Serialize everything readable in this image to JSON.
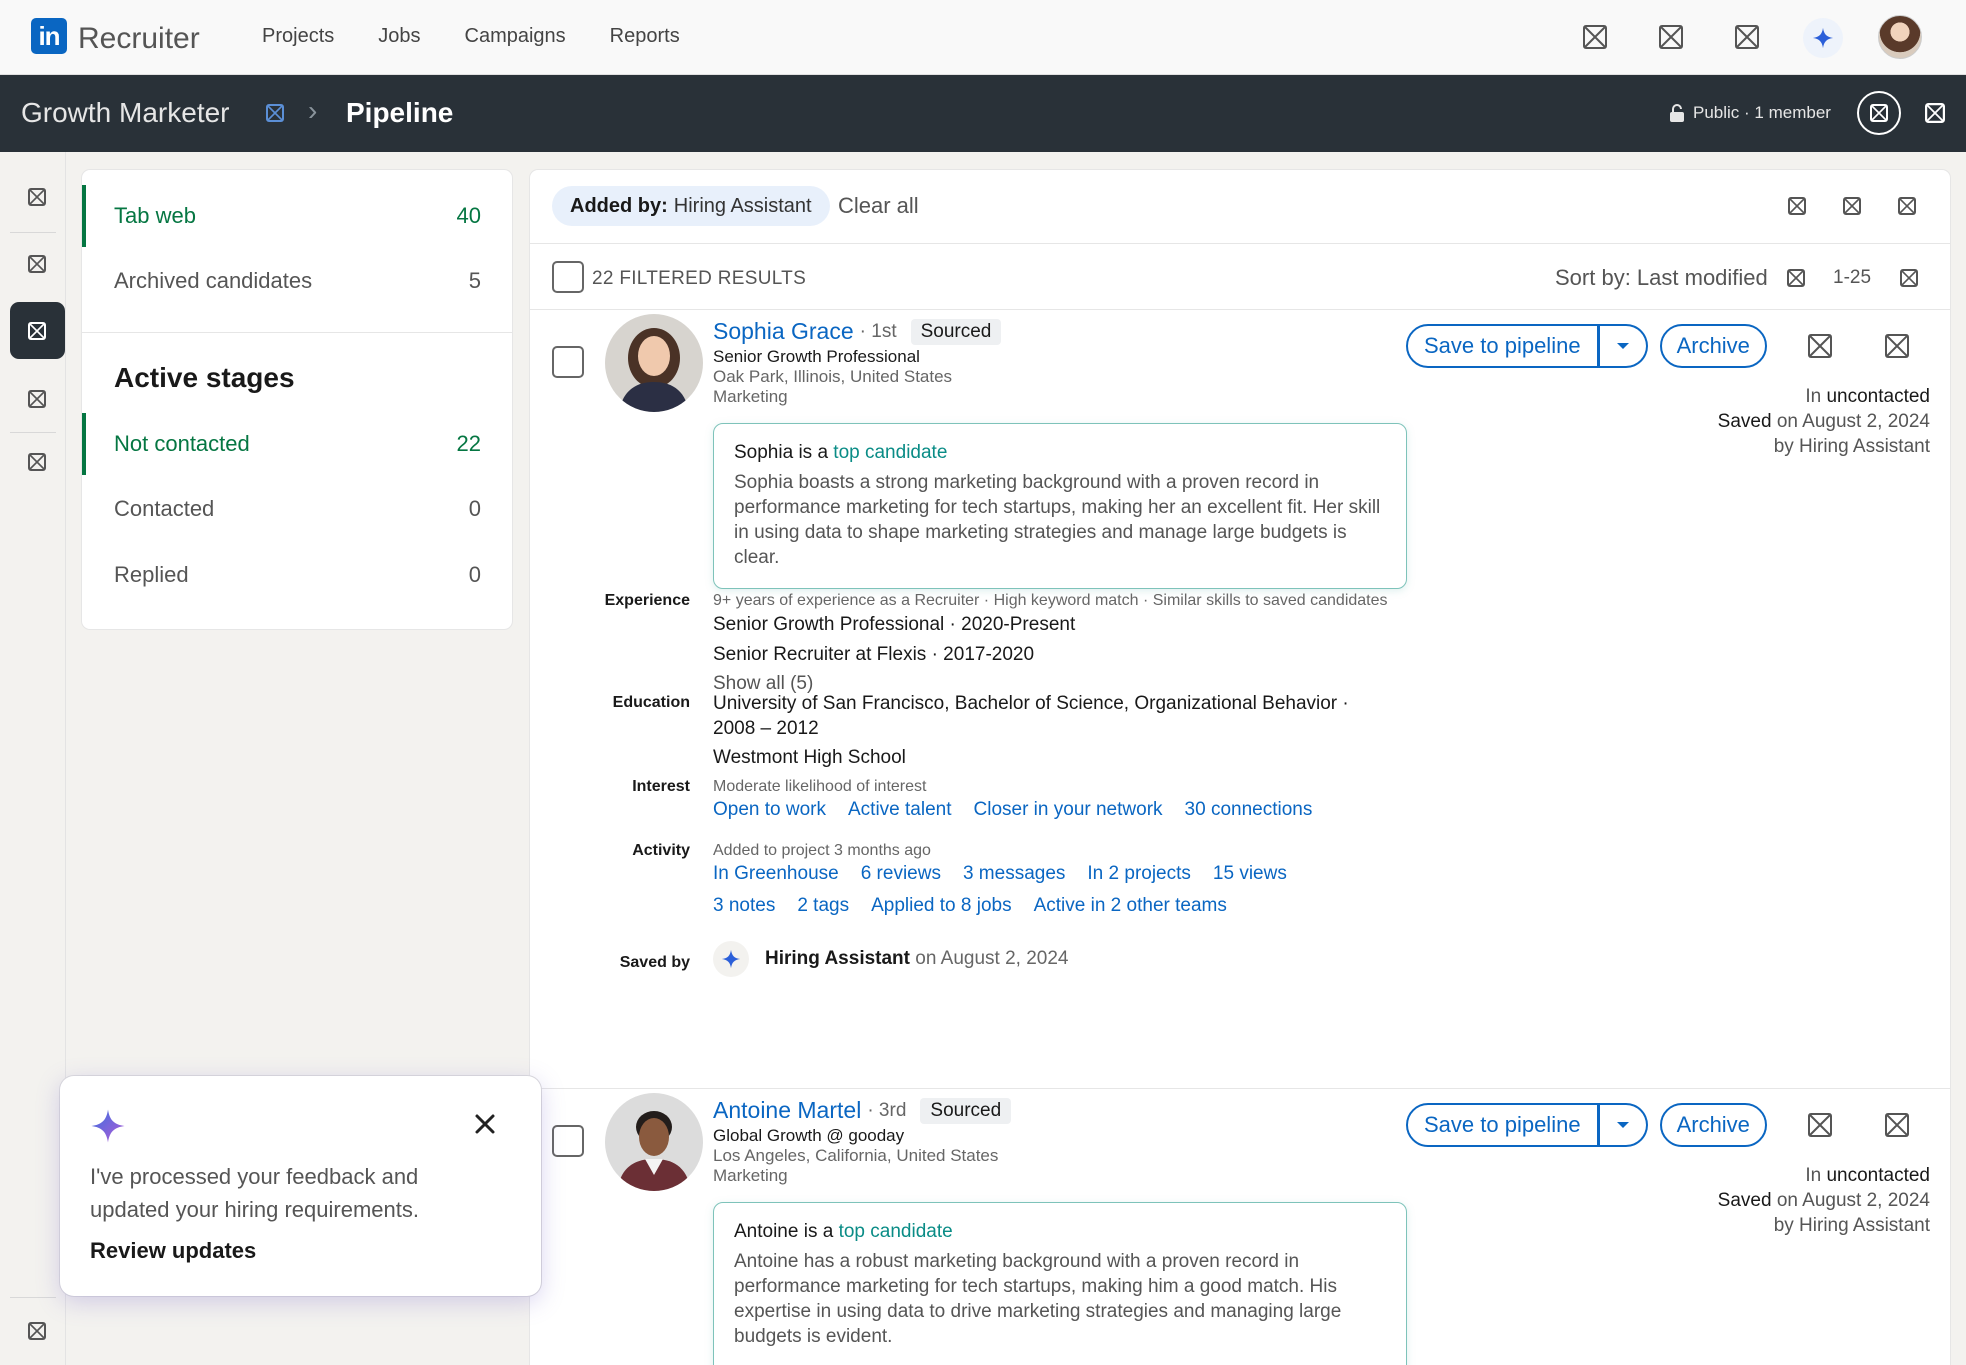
{
  "nav": {
    "logo_letters": "in",
    "product": "Recruiter",
    "links": [
      "Projects",
      "Jobs",
      "Campaigns",
      "Reports"
    ]
  },
  "header": {
    "project": "Growth Marketer",
    "page": "Pipeline",
    "visibility": "Public · 1 member"
  },
  "stages": {
    "tabs": [
      {
        "label": "Tab web",
        "count": "40"
      },
      {
        "label": "Archived candidates",
        "count": "5"
      }
    ],
    "heading": "Active stages",
    "items": [
      {
        "label": "Not contacted",
        "count": "22"
      },
      {
        "label": "Contacted",
        "count": "0"
      },
      {
        "label": "Replied",
        "count": "0"
      }
    ]
  },
  "filters": {
    "chip_key": "Added by:",
    "chip_value": "Hiring Assistant",
    "clear": "Clear all",
    "results": "22 FILTERED RESULTS",
    "sort": "Sort by: Last modified",
    "range": "1-25"
  },
  "actions": {
    "save": "Save to pipeline",
    "archive": "Archive"
  },
  "candidates": [
    {
      "name": "Sophia Grace",
      "degree": "· 1st",
      "badge": "Sourced",
      "headline": "Senior Growth Professional",
      "location": "Oak Park, Illinois, United States",
      "industry": "Marketing",
      "status_in_prefix": "In",
      "status_in": "uncontacted",
      "status_saved": "Saved",
      "status_date": "on August 2, 2024",
      "status_by": "by Hiring Assistant",
      "top_prefix": "Sophia is a",
      "top_link": "top candidate",
      "top_body": "Sophia boasts a strong marketing background with a proven record in performance marketing for tech startups, making her an excellent fit. Her skill in using data to shape marketing strategies and manage large budgets is clear.",
      "labels": {
        "experience": "Experience",
        "education": "Education",
        "interest": "Interest",
        "activity": "Activity",
        "saved_by": "Saved by"
      },
      "experience_sub": "9+ years of experience as a Recruiter · High keyword match · Similar skills to saved candidates",
      "experience": [
        "Senior Growth Professional · 2020-Present",
        "Senior Recruiter at Flexis · 2017-2020"
      ],
      "show_all": "Show all (5)",
      "education": [
        "University of San Francisco, Bachelor of Science, Organizational Behavior ·",
        "2008 – 2012",
        "Westmont High School"
      ],
      "interest_sub": "Moderate likelihood of interest",
      "interest_links": [
        "Open to work",
        "Active talent",
        "Closer in your network",
        "30 connections"
      ],
      "activity_sub": "Added to project 3 months ago",
      "activity_links_1": [
        "In Greenhouse",
        "6 reviews",
        "3 messages",
        "In 2 projects",
        "15 views"
      ],
      "activity_links_2": [
        "3 notes",
        "2 tags",
        "Applied to 8 jobs",
        "Active in 2 other teams"
      ],
      "saved_name": "Hiring Assistant",
      "saved_date": "on August 2, 2024"
    },
    {
      "name": "Antoine Martel",
      "degree": "· 3rd",
      "badge": "Sourced",
      "headline": "Global Growth @ gooday",
      "location": "Los Angeles, California, United States",
      "industry": "Marketing",
      "status_in_prefix": "In",
      "status_in": "uncontacted",
      "status_saved": "Saved",
      "status_date": "on August 2, 2024",
      "status_by": "by Hiring Assistant",
      "top_prefix": "Antoine is a",
      "top_link": "top candidate",
      "top_body": "Antoine has a robust marketing background with a proven record in performance marketing for tech startups, making him a good match. His expertise in using data to drive marketing strategies and managing large budgets is evident."
    }
  ],
  "toast": {
    "message": "I've processed your feedback and updated your hiring requirements.",
    "link": "Review updates"
  },
  "colors": {
    "brand": "#0a66c2",
    "dark_header": "#293138",
    "active_stage": "#057642",
    "top_candidate": "#0a8c86"
  },
  "icons": {
    "placeholder": "broken-image-icon",
    "sparkle": "sparkle-icon",
    "lock": "lock-icon",
    "close": "close-icon",
    "edit": "edit-icon",
    "chevron": "chevron-down-icon"
  }
}
